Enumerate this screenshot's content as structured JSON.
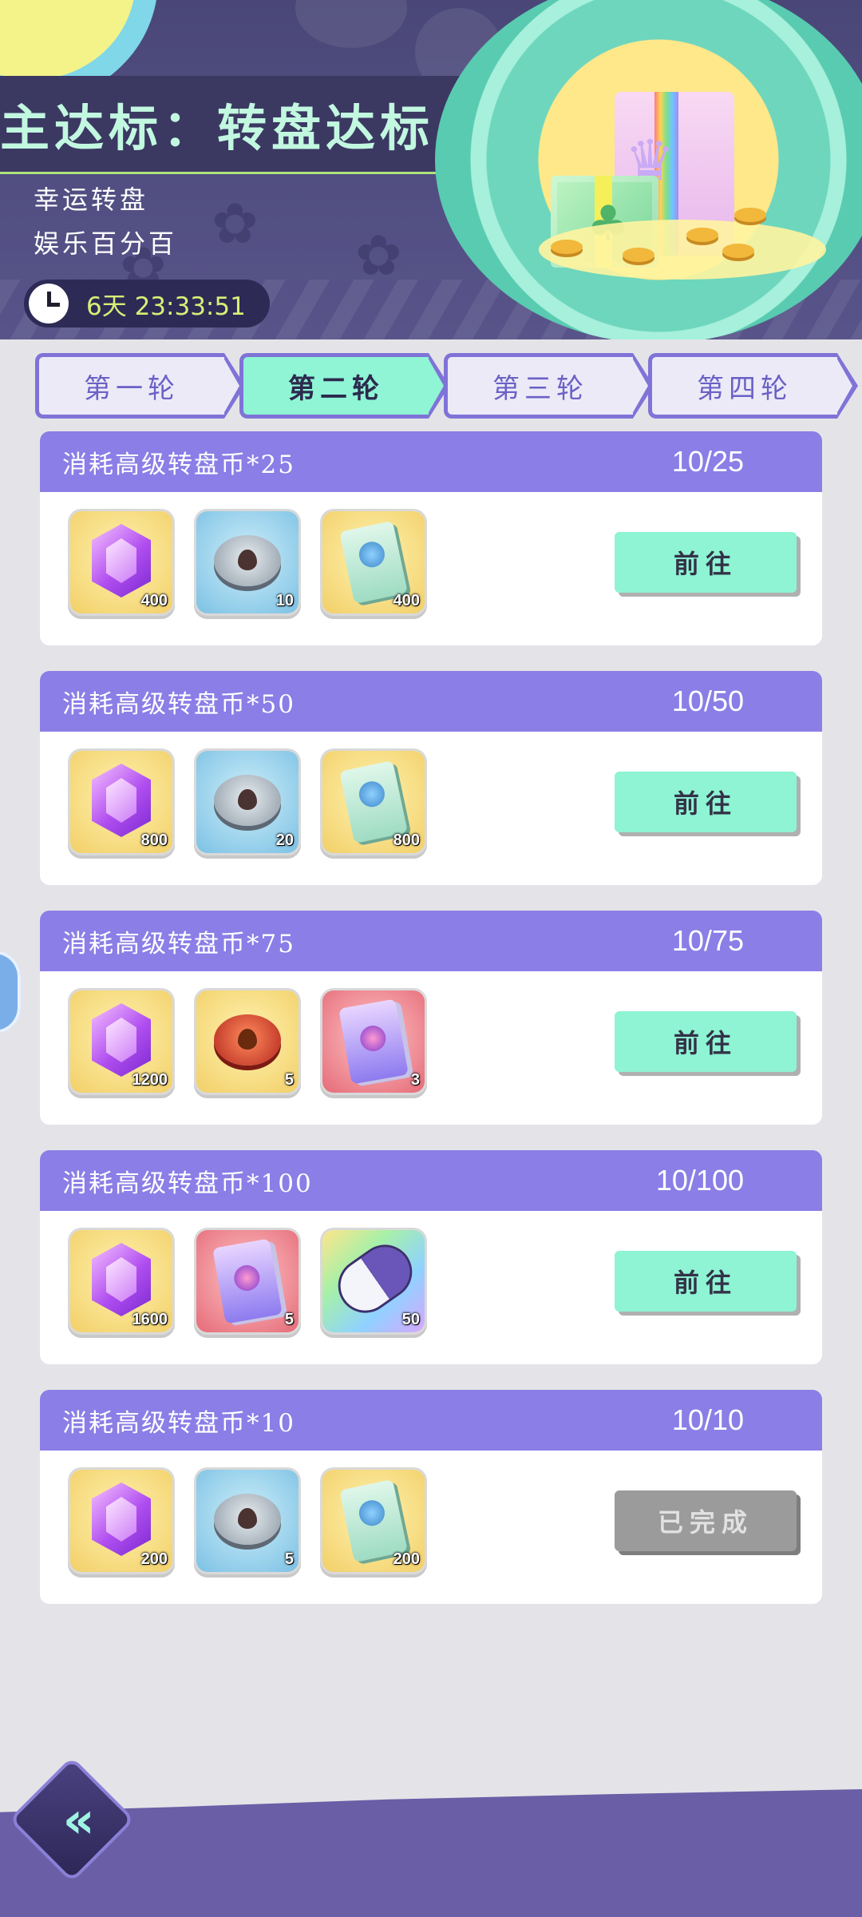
{
  "header": {
    "title": "主达标：转盘达标",
    "subtitle1": "幸运转盘",
    "subtitle2": "娱乐百分百",
    "countdown": "6天  23:33:51"
  },
  "tabs": [
    {
      "label": "第一轮",
      "active": false
    },
    {
      "label": "第二轮",
      "active": true
    },
    {
      "label": "第三轮",
      "active": false
    },
    {
      "label": "第四轮",
      "active": false
    }
  ],
  "tasks": [
    {
      "title": "消耗高级转盘币*25",
      "progress": "10/25",
      "button": "前往",
      "rewards": [
        {
          "icon": "gem",
          "qty": "400"
        },
        {
          "icon": "silver-coin",
          "qty": "10"
        },
        {
          "icon": "ticket",
          "qty": "400"
        }
      ]
    },
    {
      "title": "消耗高级转盘币*50",
      "progress": "10/50",
      "button": "前往",
      "rewards": [
        {
          "icon": "gem",
          "qty": "800"
        },
        {
          "icon": "silver-coin",
          "qty": "20"
        },
        {
          "icon": "ticket",
          "qty": "800"
        }
      ]
    },
    {
      "title": "消耗高级转盘币*75",
      "progress": "10/75",
      "button": "前往",
      "rewards": [
        {
          "icon": "gem",
          "qty": "1200"
        },
        {
          "icon": "gold-coin",
          "qty": "5"
        },
        {
          "icon": "card",
          "qty": "3"
        }
      ]
    },
    {
      "title": "消耗高级转盘币*100",
      "progress": "10/100",
      "button": "前往",
      "rewards": [
        {
          "icon": "gem",
          "qty": "1600"
        },
        {
          "icon": "card",
          "qty": "5"
        },
        {
          "icon": "capsule",
          "qty": "50"
        }
      ]
    },
    {
      "title": "消耗高级转盘币*10",
      "progress": "10/10",
      "button": "已完成",
      "rewards": [
        {
          "icon": "gem",
          "qty": "200"
        },
        {
          "icon": "silver-coin",
          "qty": "5"
        },
        {
          "icon": "ticket",
          "qty": "200"
        }
      ]
    }
  ],
  "colors": {
    "accent": "#8b7ee6",
    "button": "#8ef4d3",
    "button_done": "#9b9b9b",
    "header_bg": "#4a4778"
  },
  "icons": {
    "back": "double-chevron-left-icon",
    "clock": "clock-icon"
  }
}
